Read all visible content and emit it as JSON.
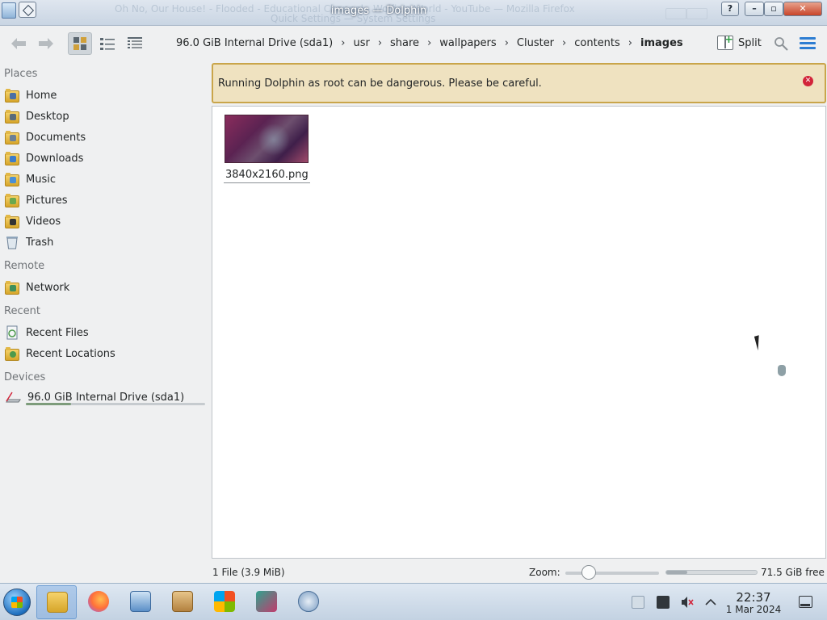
{
  "window": {
    "title": "images — Dolphin",
    "background_title_1": "Oh No, Our House! - Flooded - Educational Channel - Wolfie's World - YouTube — Mozilla Firefox",
    "background_title_2": "Quick Settings — System Settings",
    "help_label": "?",
    "minimize_label": "–",
    "maximize_label": "▫",
    "close_label": "✕"
  },
  "toolbar": {
    "back_icon": "back-arrow-icon",
    "forward_icon": "forward-arrow-icon",
    "view_modes": [
      "icons-view",
      "compact-view",
      "details-view"
    ],
    "split_label": "Split",
    "breadcrumbs": [
      "96.0 GiB Internal Drive (sda1)",
      "usr",
      "share",
      "wallpapers",
      "Cluster",
      "contents",
      "images"
    ],
    "separator": "›"
  },
  "sidebar": {
    "sections": [
      {
        "header": "Places",
        "items": [
          {
            "label": "Home",
            "icon": "home-folder-icon"
          },
          {
            "label": "Desktop",
            "icon": "desktop-folder-icon"
          },
          {
            "label": "Documents",
            "icon": "documents-folder-icon"
          },
          {
            "label": "Downloads",
            "icon": "downloads-folder-icon"
          },
          {
            "label": "Music",
            "icon": "music-folder-icon"
          },
          {
            "label": "Pictures",
            "icon": "pictures-folder-icon"
          },
          {
            "label": "Videos",
            "icon": "videos-folder-icon"
          },
          {
            "label": "Trash",
            "icon": "trash-icon"
          }
        ]
      },
      {
        "header": "Remote",
        "items": [
          {
            "label": "Network",
            "icon": "network-folder-icon"
          }
        ]
      },
      {
        "header": "Recent",
        "items": [
          {
            "label": "Recent Files",
            "icon": "recent-files-icon"
          },
          {
            "label": "Recent Locations",
            "icon": "recent-locations-icon"
          }
        ]
      },
      {
        "header": "Devices",
        "items": [
          {
            "label": "96.0 GiB Internal Drive (sda1)",
            "icon": "drive-icon",
            "usage_fraction": 0.25
          }
        ]
      }
    ]
  },
  "banner": {
    "message": "Running Dolphin as root can be dangerous. Please be careful.",
    "close_icon": "close-circle-icon",
    "colors": {
      "background": "#efe2c0",
      "border": "#c9a54a",
      "close": "#d2243a"
    }
  },
  "files": [
    {
      "name": "3840x2160.png",
      "type": "image"
    }
  ],
  "status": {
    "count": "1 File (3.9 MiB)",
    "zoom_label": "Zoom:",
    "zoom_level_fraction": 0.25,
    "free_space": "71.5 GiB free",
    "used_fraction": 0.23
  },
  "taskbar": {
    "apps": [
      {
        "name": "file-manager",
        "active": true
      },
      {
        "name": "firefox",
        "active": false
      },
      {
        "name": "system-settings",
        "active": false
      },
      {
        "name": "package-manager",
        "active": false
      },
      {
        "name": "windows-app",
        "active": false
      },
      {
        "name": "image-viewer",
        "active": false
      },
      {
        "name": "network-tool",
        "active": false
      }
    ],
    "tray_icons": [
      "clipboard-icon",
      "notes-icon",
      "volume-muted-icon",
      "tray-expand-icon"
    ],
    "time": "22:37",
    "date": "1 Mar 2024"
  }
}
